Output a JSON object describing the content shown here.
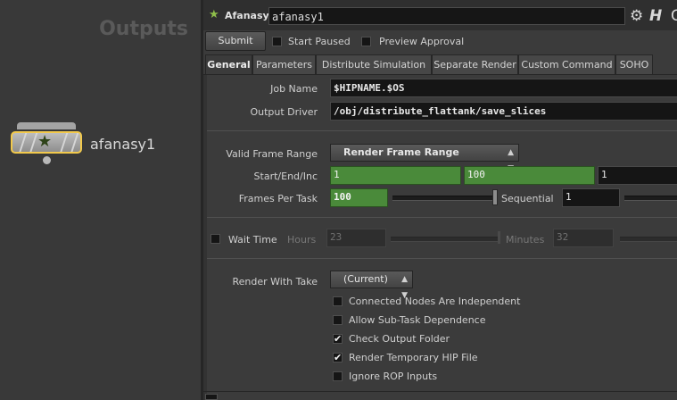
{
  "network": {
    "context_title": "Outputs",
    "node": {
      "name": "afanasy1",
      "icon": "star-icon"
    }
  },
  "header": {
    "node_type": "Afanasy",
    "node_name": "afanasy1",
    "gear_icon": "gear-icon",
    "help_icon": "help-icon"
  },
  "toolbar": {
    "submit_label": "Submit",
    "start_paused": {
      "label": "Start Paused",
      "checked": false
    },
    "preview_approval": {
      "label": "Preview Approval",
      "checked": false
    }
  },
  "tabs": [
    {
      "label": "General",
      "active": true
    },
    {
      "label": "Parameters",
      "active": false
    },
    {
      "label": "Distribute Simulation",
      "active": false
    },
    {
      "label": "Separate Render",
      "active": false
    },
    {
      "label": "Custom Command",
      "active": false
    },
    {
      "label": "SOHO",
      "active": false
    }
  ],
  "general": {
    "job_name": {
      "label": "Job Name",
      "value": "$HIPNAME.$OS"
    },
    "output_driver": {
      "label": "Output Driver",
      "value": "/obj/distribute_flattank/save_slices"
    },
    "valid_frame_range": {
      "label": "Valid Frame Range",
      "value": "Render Frame Range"
    },
    "start_end_inc": {
      "label": "Start/End/Inc",
      "start": "1",
      "end": "100",
      "inc": "1"
    },
    "frames_per_task": {
      "label": "Frames Per Task",
      "value": "100",
      "slider_level": 1.0
    },
    "sequential": {
      "label": "Sequential",
      "value": "1"
    },
    "wait_time": {
      "label": "Wait Time",
      "checked": false,
      "hours_label": "Hours",
      "hours_value": "23",
      "minutes_label": "Minutes",
      "minutes_value": "32"
    },
    "render_with_take": {
      "label": "Render With Take",
      "value": "(Current)"
    },
    "options": [
      {
        "label": "Connected Nodes Are Independent",
        "checked": false
      },
      {
        "label": "Allow Sub-Task Dependence",
        "checked": false
      },
      {
        "label": "Check Output Folder",
        "checked": true
      },
      {
        "label": "Render Temporary HIP File",
        "checked": true
      },
      {
        "label": "Ignore ROP Inputs",
        "checked": false
      }
    ]
  },
  "colors": {
    "accent_green": "#4a8a3a",
    "node_selected": "#f2c94c"
  }
}
